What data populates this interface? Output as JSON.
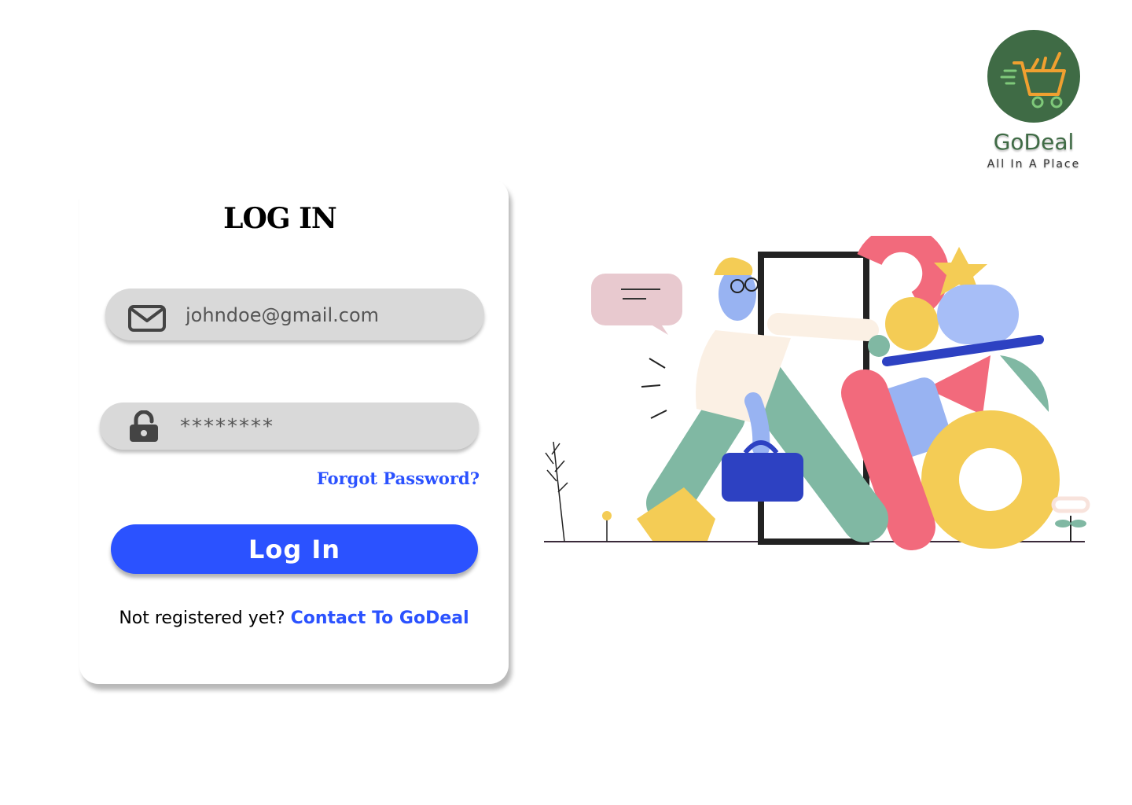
{
  "brand": {
    "name": "GoDeal",
    "tagline": "All In A Place",
    "logo_icon": "shopping-cart-icon",
    "color": "#3f6b45"
  },
  "login_form": {
    "title": "LOG IN",
    "email": {
      "icon": "mail-icon",
      "placeholder": "johndoe@gmail.com",
      "value": ""
    },
    "password": {
      "icon": "unlock-icon",
      "placeholder": "********",
      "value": ""
    },
    "forgot_password": "Forgot Password?",
    "submit_label": "Log In",
    "register_prompt": "Not registered yet?",
    "register_link": "Contact To GoDeal"
  },
  "colors": {
    "accent": "#2b52ff",
    "field_bg": "#d9d9d9"
  },
  "illustration": {
    "icon": "person-entering-door-illustration"
  }
}
